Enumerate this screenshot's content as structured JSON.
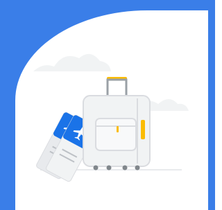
{
  "screen": {
    "background_color": "#3a7ee8",
    "card_color": "#ffffff"
  },
  "illustration": {
    "subject": "travel",
    "icons": [
      "cloud-icon",
      "suitcase-icon",
      "boarding-pass-icon",
      "airplane-icon"
    ],
    "colors": {
      "cloud": "#f1f3f4",
      "suitcase_body": "#f1f3f4",
      "suitcase_outline": "#dadce0",
      "handle": "#9aa0a6",
      "handle_grip": "#fbbc04",
      "accent": "#fbbc04",
      "wheels": "#80868b",
      "ticket_blue": "#1a73e8",
      "ticket_stub": "#e8eaed"
    }
  }
}
